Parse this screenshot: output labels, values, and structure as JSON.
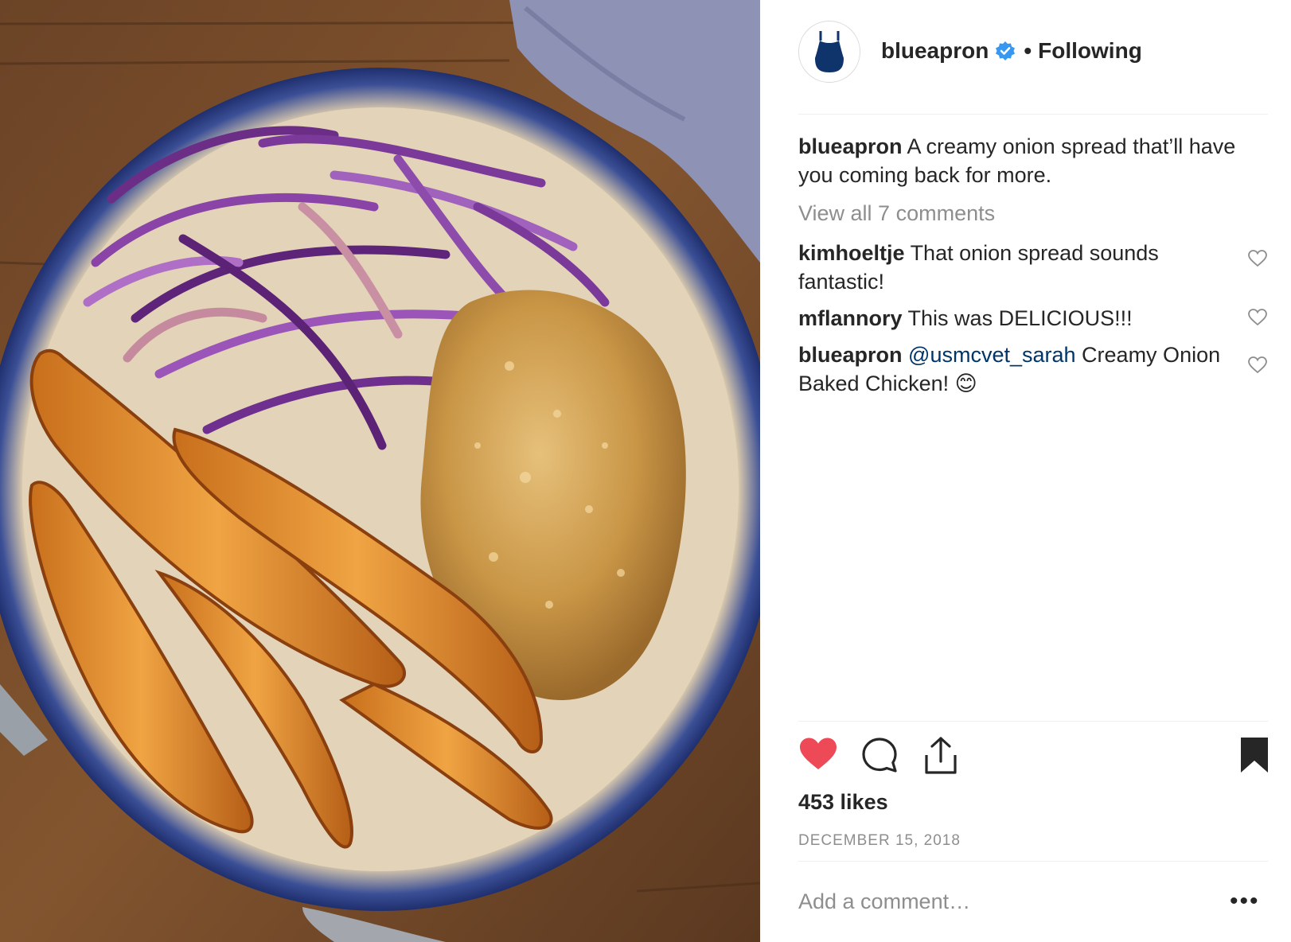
{
  "post": {
    "image_alt": "Plate with sweet potato wedges, purple cabbage slaw, and crusted chicken",
    "account": {
      "username": "blueapron",
      "follow_status": "Following",
      "verified": true
    },
    "caption": {
      "username": "blueapron",
      "text": "A creamy onion spread that’ll have you coming back for more."
    },
    "view_all_comments": "View all 7 comments",
    "comments": [
      {
        "username": "kimhoeltje",
        "mention": "",
        "text": "That onion spread sounds fantastic!"
      },
      {
        "username": "mflannory",
        "mention": "",
        "text": "This was DELICIOUS!!!"
      },
      {
        "username": "blueapron",
        "mention": "@usmcvet_sarah",
        "text": "Creamy Onion Baked Chicken! 😊"
      }
    ],
    "likes": "453 likes",
    "date": "DECEMBER 15, 2018",
    "add_comment_placeholder": "Add a comment…",
    "more_label": "•••",
    "icons": {
      "like": "heart-filled-icon",
      "comment": "comment-bubble-icon",
      "share": "share-upload-icon",
      "save": "bookmark-filled-icon",
      "comment_like": "heart-outline-icon",
      "verified": "verified-badge-icon",
      "avatar": "apron-logo-icon"
    },
    "colors": {
      "like_red": "#ed4956",
      "verified_blue": "#3897f0",
      "brand_navy": "#0f346c",
      "text_dark": "#262626",
      "text_muted": "#8e8e8e",
      "mention": "#003569"
    }
  }
}
